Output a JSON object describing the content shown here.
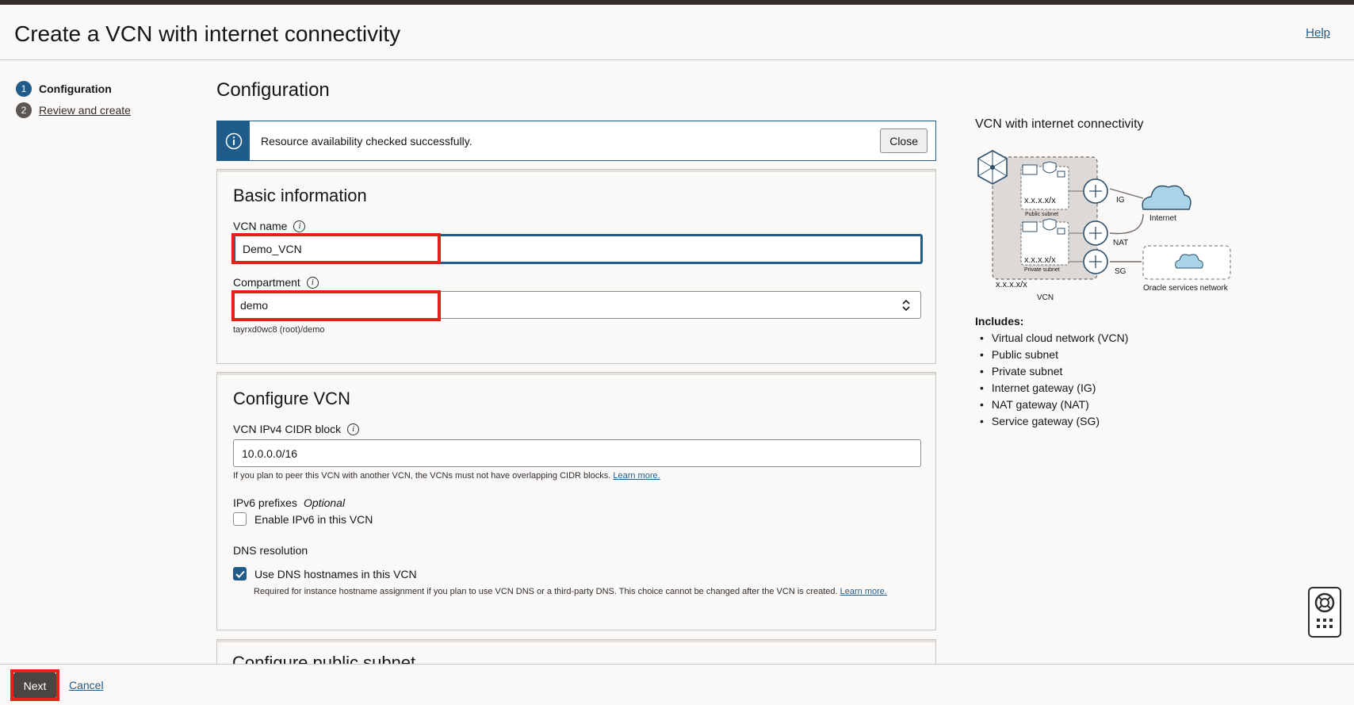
{
  "page": {
    "title": "Create a VCN with internet connectivity",
    "help_label": "Help"
  },
  "steps": [
    {
      "number": "1",
      "label": "Configuration"
    },
    {
      "number": "2",
      "label": "Review and create"
    }
  ],
  "main": {
    "section_title": "Configuration",
    "notice": {
      "message": "Resource availability checked successfully.",
      "close_label": "Close"
    },
    "basic_info": {
      "title": "Basic information",
      "vcn_name_label": "VCN name",
      "vcn_name_value": "Demo_VCN",
      "compartment_label": "Compartment",
      "compartment_value": "demo",
      "compartment_path": "tayrxd0wc8 (root)/demo"
    },
    "configure_vcn": {
      "title": "Configure VCN",
      "cidr_label": "VCN IPv4 CIDR block",
      "cidr_value": "10.0.0.0/16",
      "cidr_hint": "If you plan to peer this VCN with another VCN, the VCNs must not have overlapping CIDR blocks.",
      "learn_more": "Learn more.",
      "ipv6_label": "IPv6 prefixes",
      "ipv6_optional": "Optional",
      "ipv6_checkbox_label": "Enable IPv6 in this VCN",
      "dns_label": "DNS resolution",
      "dns_checkbox_label": "Use DNS hostnames in this VCN",
      "dns_hint": "Required for instance hostname assignment if you plan to use VCN DNS or a third-party DNS. This choice cannot be changed after the VCN is created.",
      "dns_learn_more": "Learn more."
    },
    "next_card_title": "Configure public subnet"
  },
  "side": {
    "title": "VCN with internet connectivity",
    "diagram": {
      "public_cidr": "x.x.x.x/x",
      "public_subnet": "Public subnet",
      "private_cidr": "x.x.x.x/x",
      "private_subnet": "Private subnet",
      "vcn_cidr": "x.x.x.x/x",
      "vcn_label": "VCN",
      "ig_label": "IG",
      "nat_label": "NAT",
      "sg_label": "SG",
      "internet_label": "Internet",
      "oracle_services_label": "Oracle services network"
    },
    "includes_title": "Includes:",
    "includes": [
      "Virtual cloud network (VCN)",
      "Public subnet",
      "Private subnet",
      "Internet gateway (IG)",
      "NAT gateway (NAT)",
      "Service gateway (SG)"
    ]
  },
  "footer": {
    "next_label": "Next",
    "cancel_label": "Cancel"
  },
  "colors": {
    "accent": "#1f5c8a",
    "highlight": "#e32119",
    "primary_button": "#4a4541"
  }
}
